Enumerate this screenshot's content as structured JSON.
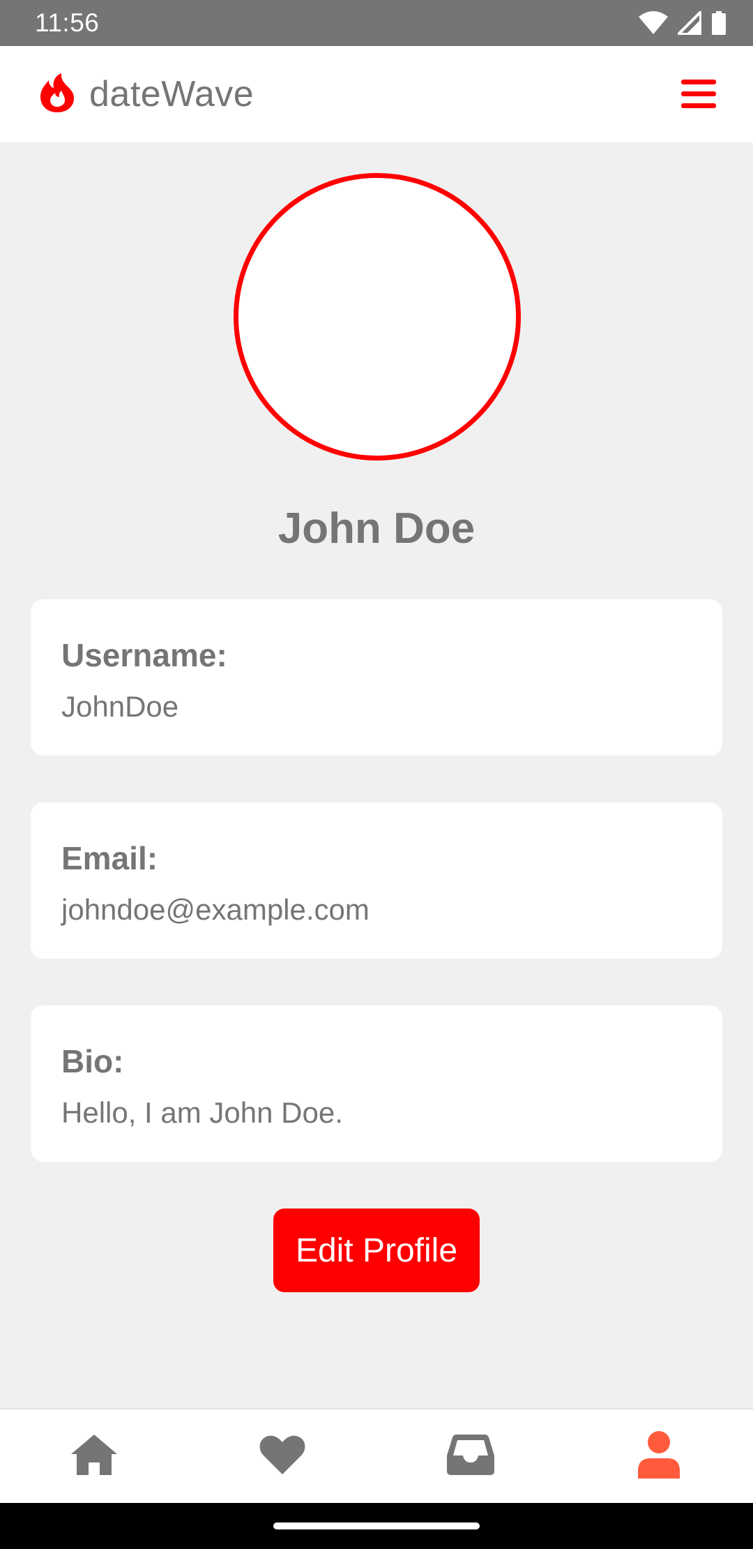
{
  "status_bar": {
    "time": "11:56",
    "icons": [
      "wifi-icon",
      "signal-icon",
      "battery-icon"
    ]
  },
  "header": {
    "logo_icon": "flame-icon",
    "app_name": "dateWave",
    "menu_icon": "hamburger-menu-icon"
  },
  "profile": {
    "name": "John Doe",
    "fields": [
      {
        "label": "Username:",
        "value": "JohnDoe"
      },
      {
        "label": "Email:",
        "value": "johndoe@example.com"
      },
      {
        "label": "Bio:",
        "value": "Hello, I am John Doe."
      }
    ],
    "edit_button_label": "Edit Profile"
  },
  "bottom_nav": {
    "items": [
      {
        "icon": "home-icon",
        "active": false
      },
      {
        "icon": "heart-icon",
        "active": false
      },
      {
        "icon": "inbox-icon",
        "active": false
      },
      {
        "icon": "profile-icon",
        "active": true
      }
    ]
  },
  "colors": {
    "accent": "#ff0000",
    "active_nav": "#ff5a3c",
    "inactive_nav": "#757575",
    "text_gray": "#757575",
    "background": "#f0f0f0"
  }
}
